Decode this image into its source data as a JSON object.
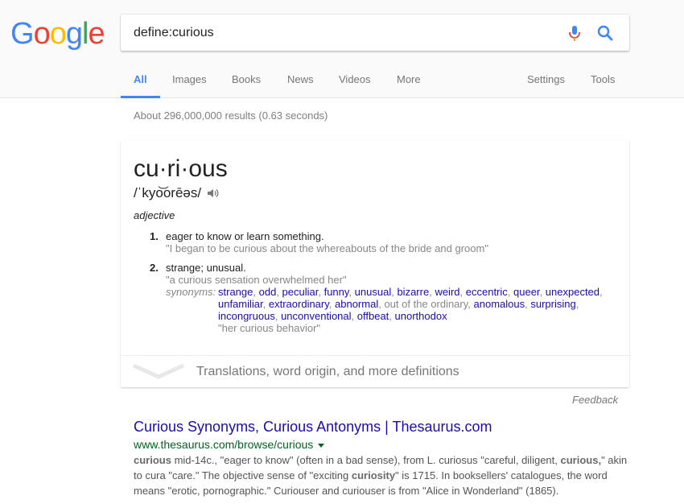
{
  "header": {
    "logo_letters": [
      {
        "ch": "G",
        "color": "#4285f4"
      },
      {
        "ch": "o",
        "color": "#ea4335"
      },
      {
        "ch": "o",
        "color": "#fbbc05"
      },
      {
        "ch": "g",
        "color": "#4285f4"
      },
      {
        "ch": "l",
        "color": "#34a853"
      },
      {
        "ch": "e",
        "color": "#ea4335"
      }
    ],
    "search_value": "define:curious",
    "mic_icon": "microphone-icon",
    "search_icon": "magnifier-icon"
  },
  "tabs": {
    "all": "All",
    "images": "Images",
    "books": "Books",
    "news": "News",
    "videos": "Videos",
    "more": "More",
    "settings": "Settings",
    "tools": "Tools"
  },
  "stats": "About 296,000,000 results (0.63 seconds)",
  "definition": {
    "word": "cu·ri·ous",
    "phonetic": "/ˈkyo͝orēəs/",
    "part_of_speech": "adjective",
    "sense1": {
      "num": "1.",
      "def": "eager to know or learn something.",
      "example": "\"I began to be curious about the whereabouts of the bride and groom\""
    },
    "sense2": {
      "num": "2.",
      "def": "strange; unusual.",
      "example": "\"a curious sensation overwhelmed her\"",
      "synonyms_label": "synonyms:",
      "syn": {
        "s1": "strange",
        "s2": "odd",
        "s3": "peculiar",
        "s4": "funny",
        "s5": "unusual",
        "s6": "bizarre",
        "s7": "weird",
        "s8": "eccentric",
        "s9": "queer",
        "s10": "unexpected",
        "s11": "unfamiliar",
        "s12": "extraordinary",
        "s13": "abnormal",
        "plain": "out of the ordinary",
        "s14": "anomalous",
        "s15": "surprising",
        "s16": "incongruous",
        "s17": "unconventional",
        "s18": "offbeat",
        "s19": "unorthodox"
      },
      "syn_example": "\"her curious behavior\""
    },
    "more_label": "Translations, word origin, and more definitions"
  },
  "feedback": "Feedback",
  "result": {
    "title": "Curious Synonyms, Curious Antonyms | Thesaurus.com",
    "url": "www.thesaurus.com/browse/curious",
    "snippet": {
      "b1": "curious",
      "t1": " mid-14c., \"eager to know\" (often in a bad sense), from L. curiosus \"careful, diligent, ",
      "b2": "curious,",
      "t2": "\" akin to cura \"care.\" The objective sense of \"exciting ",
      "b3": "curiosity",
      "t3": "\" is 1715. In booksellers' catalogues, the word means \"erotic, pornographic.\" Curiouser and curiouser is from \"Alice in Wonderland\" (1865)."
    }
  }
}
